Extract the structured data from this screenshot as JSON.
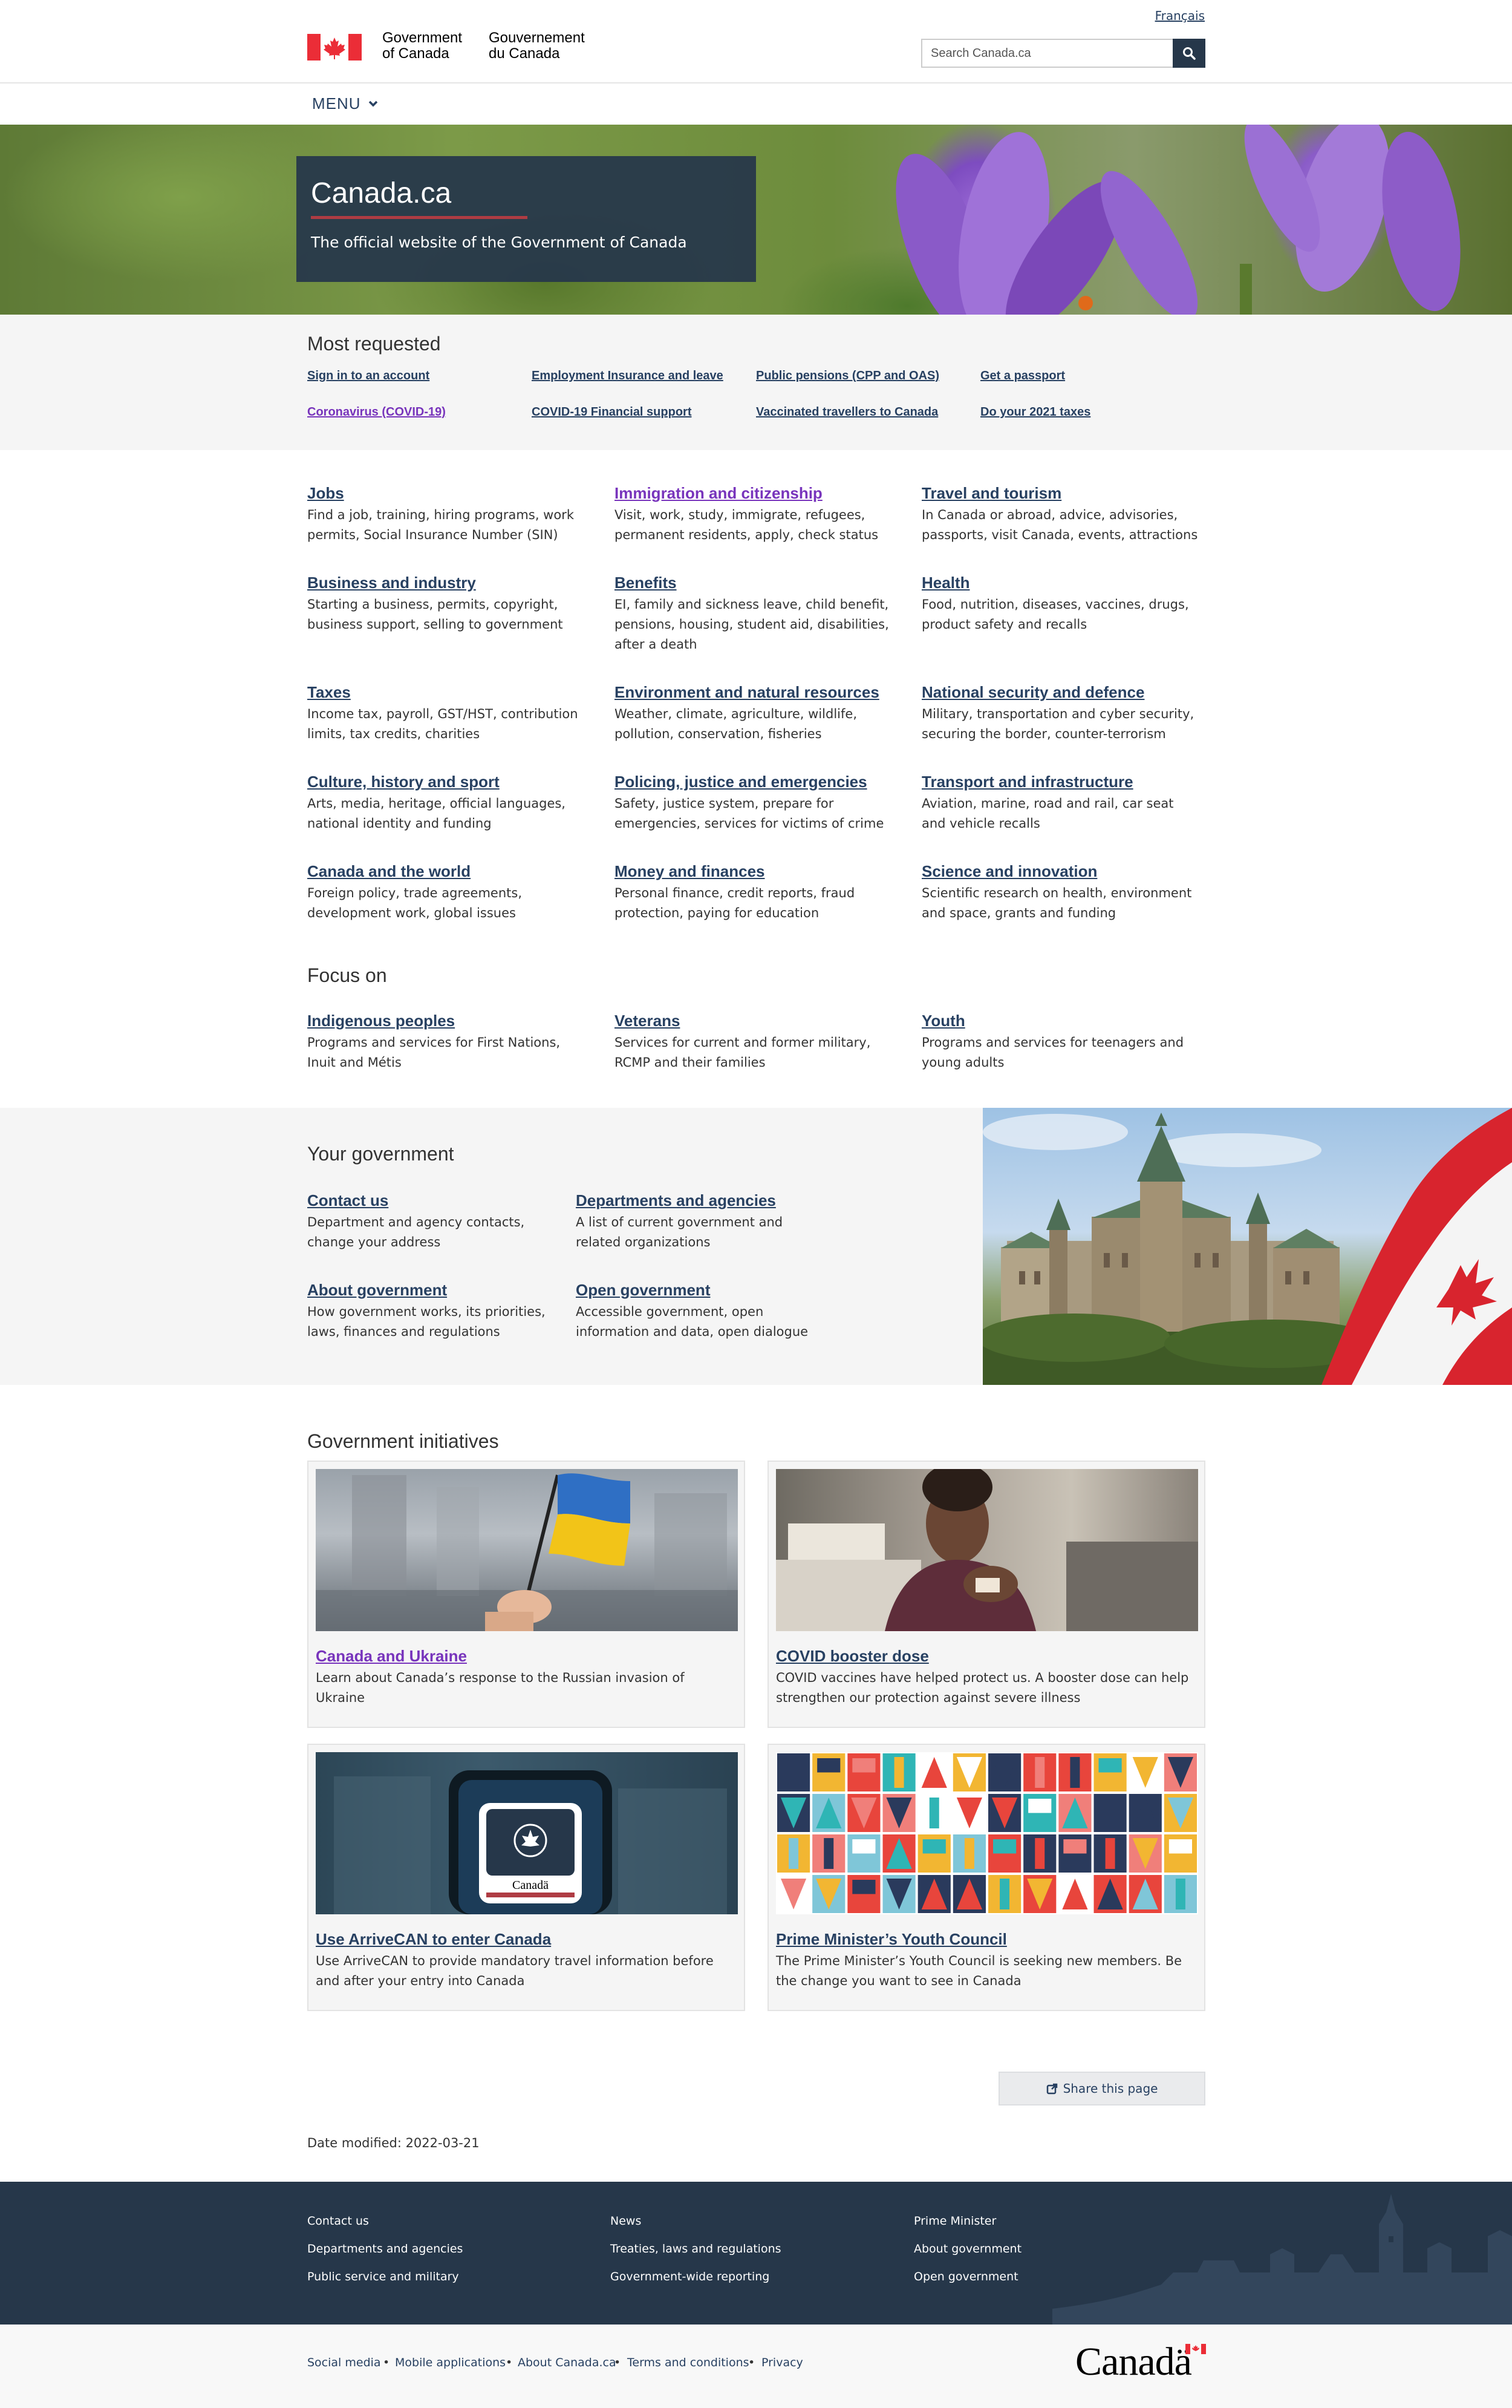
{
  "header": {
    "lang_toggle": "Français",
    "signature_en": "Government\nof Canada",
    "signature_fr": "Gouvernement\ndu Canada",
    "search_placeholder": "Search Canada.ca",
    "menu_label": "MENU"
  },
  "hero": {
    "title": "Canada.ca",
    "subtitle": "The official website of the Government of Canada"
  },
  "most_requested": {
    "title": "Most requested",
    "links": [
      "Sign in to an account",
      "Employment Insurance and leave",
      "Public pensions (CPP and OAS)",
      "Get a passport",
      "Coronavirus (COVID-19)",
      "COVID-19 Financial support",
      "Vaccinated travellers to Canada",
      "Do your 2021 taxes"
    ]
  },
  "topics": [
    {
      "title": "Jobs",
      "desc": "Find a job, training, hiring programs, work permits, Social Insurance Number (SIN)"
    },
    {
      "title": "Immigration and citizenship",
      "desc": "Visit, work, study, immigrate, refugees, permanent residents, apply, check status"
    },
    {
      "title": "Travel and tourism",
      "desc": "In Canada or abroad, advice, advisories, passports, visit Canada, events, attractions"
    },
    {
      "title": "Business and industry",
      "desc": "Starting a business, permits, copyright, business support, selling to government"
    },
    {
      "title": "Benefits",
      "desc": "EI, family and sickness leave, child benefit, pensions, housing, student aid, disabilities, after a death"
    },
    {
      "title": "Health",
      "desc": "Food, nutrition, diseases, vaccines, drugs, product safety and recalls"
    },
    {
      "title": "Taxes",
      "desc": "Income tax, payroll, GST/HST, contribution limits, tax credits, charities"
    },
    {
      "title": "Environment and natural resources",
      "desc": "Weather, climate, agriculture, wildlife, pollution, conservation, fisheries"
    },
    {
      "title": "National security and defence",
      "desc": "Military, transportation and cyber security, securing the border, counter-terrorism"
    },
    {
      "title": "Culture, history and sport",
      "desc": "Arts, media, heritage, official languages, national identity and funding"
    },
    {
      "title": "Policing, justice and emergencies",
      "desc": "Safety, justice system, prepare for emergencies, services for victims of crime"
    },
    {
      "title": "Transport and infrastructure",
      "desc": "Aviation, marine, road and rail, car seat and vehicle recalls"
    },
    {
      "title": "Canada and the world",
      "desc": "Foreign policy, trade agreements, development work, global issues"
    },
    {
      "title": "Money and finances",
      "desc": "Personal finance, credit reports, fraud protection, paying for education"
    },
    {
      "title": "Science and innovation",
      "desc": "Scientific research on health, environment and space, grants and funding"
    }
  ],
  "focus_on": {
    "title": "Focus on",
    "items": [
      {
        "title": "Indigenous peoples",
        "desc": "Programs and services for First Nations, Inuit and Métis"
      },
      {
        "title": "Veterans",
        "desc": "Services for current and former military, RCMP and their families"
      },
      {
        "title": "Youth",
        "desc": "Programs and services for teenagers and young adults"
      }
    ]
  },
  "your_government": {
    "title": "Your government",
    "items": [
      {
        "title": "Contact us",
        "desc": "Department and agency contacts, change your address"
      },
      {
        "title": "Departments and agencies",
        "desc": "A list of current government and related organizations"
      },
      {
        "title": "About government",
        "desc": "How government works, its priorities, laws, finances and regulations"
      },
      {
        "title": "Open government",
        "desc": "Accessible government, open information and data, open dialogue"
      }
    ]
  },
  "initiatives": {
    "title": "Government initiatives",
    "cards": [
      {
        "title": "Canada and Ukraine",
        "desc": "Learn about Canada’s response to the Russian invasion of Ukraine"
      },
      {
        "title": "COVID booster dose",
        "desc": "COVID vaccines have helped protect us. A booster dose can help strengthen our protection against severe illness"
      },
      {
        "title": "Use ArriveCAN to enter Canada",
        "desc": "Use ArriveCAN to provide mandatory travel information before and after your entry into Canada",
        "app_label": "Canadä"
      },
      {
        "title": "Prime Minister’s Youth Council",
        "desc": "The Prime Minister’s Youth Council is seeking new members. Be the change you want to see in Canada"
      }
    ]
  },
  "share_label": "Share this page",
  "date_modified": "Date modified: 2022-03-21",
  "footer": {
    "col1": [
      "Contact us",
      "Departments and agencies",
      "Public service and military"
    ],
    "col2": [
      "News",
      "Treaties, laws and regulations",
      "Government-wide reporting"
    ],
    "col3": [
      "Prime Minister",
      "About government",
      "Open government"
    ],
    "bottom_links": [
      "Social media",
      "Mobile applications",
      "About Canada.ca",
      "Terms and conditions",
      "Privacy"
    ],
    "wordmark": "Canadä"
  },
  "colors": {
    "brand_dark": "#26374a",
    "link": "#284162",
    "visited_link": "#7834bc",
    "accent_red": "#af3c43"
  }
}
